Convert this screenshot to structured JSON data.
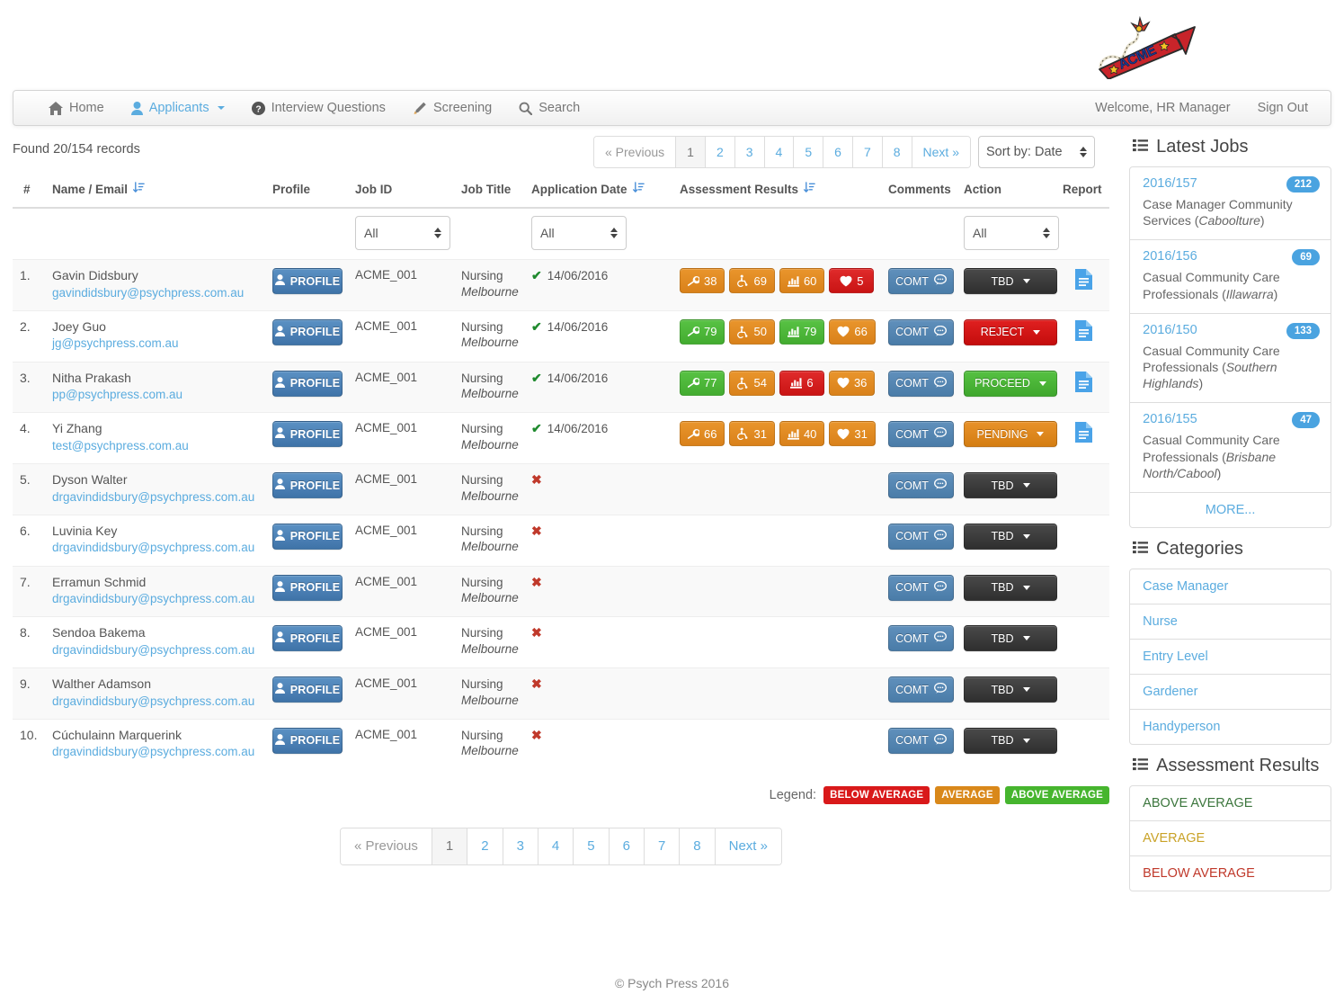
{
  "brand": {
    "logo_text": "ACME",
    "logo_alt": "acme-rocket-logo"
  },
  "nav": {
    "items": [
      {
        "label": "Home",
        "icon": "home-icon",
        "style": "plain"
      },
      {
        "label": "Applicants",
        "icon": "user-icon",
        "style": "link",
        "caret": true
      },
      {
        "label": "Interview Questions",
        "icon": "question-circle-icon",
        "style": "plain"
      },
      {
        "label": "Screening",
        "icon": "pencil-icon",
        "style": "plain"
      },
      {
        "label": "Search",
        "icon": "search-icon",
        "style": "plain"
      }
    ],
    "welcome": "Welcome, HR Manager",
    "sign_out": "Sign Out"
  },
  "toolbar": {
    "found": "Found 20/154 records",
    "sort_label": "Sort by: Date"
  },
  "pagination": {
    "previous": "« Previous",
    "next": "Next »",
    "pages": [
      "1",
      "2",
      "3",
      "4",
      "5",
      "6",
      "7",
      "8"
    ],
    "active": "1"
  },
  "table": {
    "headers": {
      "num": "#",
      "name": "Name / Email",
      "profile": "Profile",
      "job_id": "Job ID",
      "job_title": "Job Title",
      "app_date": "Application Date",
      "assessment": "Assessment Results",
      "comments": "Comments",
      "action": "Action",
      "report": "Report"
    },
    "filters": {
      "job_id": "All",
      "app_date": "All",
      "action": "All"
    },
    "profile_label": "PROFILE",
    "comment_label": "COMT",
    "rows": [
      {
        "num": "1.",
        "name": "Gavin Didsbury",
        "email": "gavindidsbury@psychpress.com.au",
        "job_id": "ACME_001",
        "job_title": "Nursing",
        "job_location": "Melbourne",
        "applied": true,
        "date": "14/06/2016",
        "scores": [
          {
            "icon": "wrench-icon",
            "value": "38",
            "level": "avg"
          },
          {
            "icon": "wheelchair-icon",
            "value": "69",
            "level": "avg"
          },
          {
            "icon": "bar-chart-icon",
            "value": "60",
            "level": "avg"
          },
          {
            "icon": "heart-icon",
            "value": "5",
            "level": "below"
          }
        ],
        "action": "TBD",
        "action_style": "a-tbd",
        "report": true
      },
      {
        "num": "2.",
        "name": "Joey Guo",
        "email": "jg@psychpress.com.au",
        "job_id": "ACME_001",
        "job_title": "Nursing",
        "job_location": "Melbourne",
        "applied": true,
        "date": "14/06/2016",
        "scores": [
          {
            "icon": "wrench-icon",
            "value": "79",
            "level": "above"
          },
          {
            "icon": "wheelchair-icon",
            "value": "50",
            "level": "avg"
          },
          {
            "icon": "bar-chart-icon",
            "value": "79",
            "level": "above"
          },
          {
            "icon": "heart-icon",
            "value": "66",
            "level": "avg"
          }
        ],
        "action": "REJECT",
        "action_style": "a-reject",
        "report": true
      },
      {
        "num": "3.",
        "name": "Nitha Prakash",
        "email": "pp@psychpress.com.au",
        "job_id": "ACME_001",
        "job_title": "Nursing",
        "job_location": "Melbourne",
        "applied": true,
        "date": "14/06/2016",
        "scores": [
          {
            "icon": "wrench-icon",
            "value": "77",
            "level": "above"
          },
          {
            "icon": "wheelchair-icon",
            "value": "54",
            "level": "avg"
          },
          {
            "icon": "bar-chart-icon",
            "value": "6",
            "level": "below"
          },
          {
            "icon": "heart-icon",
            "value": "36",
            "level": "avg"
          }
        ],
        "action": "PROCEED",
        "action_style": "a-proceed",
        "report": true
      },
      {
        "num": "4.",
        "name": "Yi Zhang",
        "email": "test@psychpress.com.au",
        "job_id": "ACME_001",
        "job_title": "Nursing",
        "job_location": "Melbourne",
        "applied": true,
        "date": "14/06/2016",
        "scores": [
          {
            "icon": "wrench-icon",
            "value": "66",
            "level": "avg"
          },
          {
            "icon": "wheelchair-icon",
            "value": "31",
            "level": "avg"
          },
          {
            "icon": "bar-chart-icon",
            "value": "40",
            "level": "avg"
          },
          {
            "icon": "heart-icon",
            "value": "31",
            "level": "avg"
          }
        ],
        "action": "PENDING",
        "action_style": "a-pending",
        "report": true
      },
      {
        "num": "5.",
        "name": "Dyson Walter",
        "email": "drgavindidsbury@psychpress.com.au",
        "job_id": "ACME_001",
        "job_title": "Nursing",
        "job_location": "Melbourne",
        "applied": false,
        "date": "",
        "scores": [],
        "action": "TBD",
        "action_style": "a-tbd",
        "report": false
      },
      {
        "num": "6.",
        "name": "Luvinia Key",
        "email": "drgavindidsbury@psychpress.com.au",
        "job_id": "ACME_001",
        "job_title": "Nursing",
        "job_location": "Melbourne",
        "applied": false,
        "date": "",
        "scores": [],
        "action": "TBD",
        "action_style": "a-tbd",
        "report": false
      },
      {
        "num": "7.",
        "name": "Erramun Schmid",
        "email": "drgavindidsbury@psychpress.com.au",
        "job_id": "ACME_001",
        "job_title": "Nursing",
        "job_location": "Melbourne",
        "applied": false,
        "date": "",
        "scores": [],
        "action": "TBD",
        "action_style": "a-tbd",
        "report": false
      },
      {
        "num": "8.",
        "name": "Sendoa Bakema",
        "email": "drgavindidsbury@psychpress.com.au",
        "job_id": "ACME_001",
        "job_title": "Nursing",
        "job_location": "Melbourne",
        "applied": false,
        "date": "",
        "scores": [],
        "action": "TBD",
        "action_style": "a-tbd",
        "report": false
      },
      {
        "num": "9.",
        "name": "Walther Adamson",
        "email": "drgavindidsbury@psychpress.com.au",
        "job_id": "ACME_001",
        "job_title": "Nursing",
        "job_location": "Melbourne",
        "applied": false,
        "date": "",
        "scores": [],
        "action": "TBD",
        "action_style": "a-tbd",
        "report": false
      },
      {
        "num": "10.",
        "name": "Cúchulainn Marquerink",
        "email": "drgavindidsbury@psychpress.com.au",
        "job_id": "ACME_001",
        "job_title": "Nursing",
        "job_location": "Melbourne",
        "applied": false,
        "date": "",
        "scores": [],
        "action": "TBD",
        "action_style": "a-tbd",
        "report": false
      }
    ]
  },
  "legend": {
    "label": "Legend:",
    "items": [
      {
        "text": "BELOW AVERAGE",
        "cls": "b",
        "color": "#d9191a"
      },
      {
        "text": "AVERAGE",
        "cls": "a",
        "color": "#d9881a"
      },
      {
        "text": "ABOVE AVERAGE",
        "cls": "g",
        "color": "#46b52e"
      }
    ]
  },
  "sidebar": {
    "latest_jobs": {
      "title": "Latest Jobs",
      "icon": "list-icon",
      "more": "MORE...",
      "jobs": [
        {
          "id": "2016/157",
          "count": "212",
          "title": "Case Manager Community Services (",
          "location": "Caboolture",
          "suffix": ")"
        },
        {
          "id": "2016/156",
          "count": "69",
          "title": "Casual Community Care Professionals (",
          "location": "Illawarra",
          "suffix": ")"
        },
        {
          "id": "2016/150",
          "count": "133",
          "title": "Casual Community Care Professionals (",
          "location": "Southern Highlands",
          "suffix": ")"
        },
        {
          "id": "2016/155",
          "count": "47",
          "title": "Casual Community Care Professionals (",
          "location": "Brisbane North/Cabool",
          "suffix": ")"
        }
      ]
    },
    "categories": {
      "title": "Categories",
      "icon": "list-icon",
      "items": [
        "Case Manager",
        "Nurse",
        "Entry Level",
        "Gardener",
        "Handyperson"
      ]
    },
    "assessment_results": {
      "title": "Assessment Results",
      "icon": "list-icon",
      "items": [
        {
          "label": "ABOVE AVERAGE",
          "cls": "res-above"
        },
        {
          "label": "AVERAGE",
          "cls": "res-avg"
        },
        {
          "label": "BELOW AVERAGE",
          "cls": "res-below"
        }
      ]
    }
  },
  "footer": {
    "copyright": "© Psych Press 2016"
  }
}
